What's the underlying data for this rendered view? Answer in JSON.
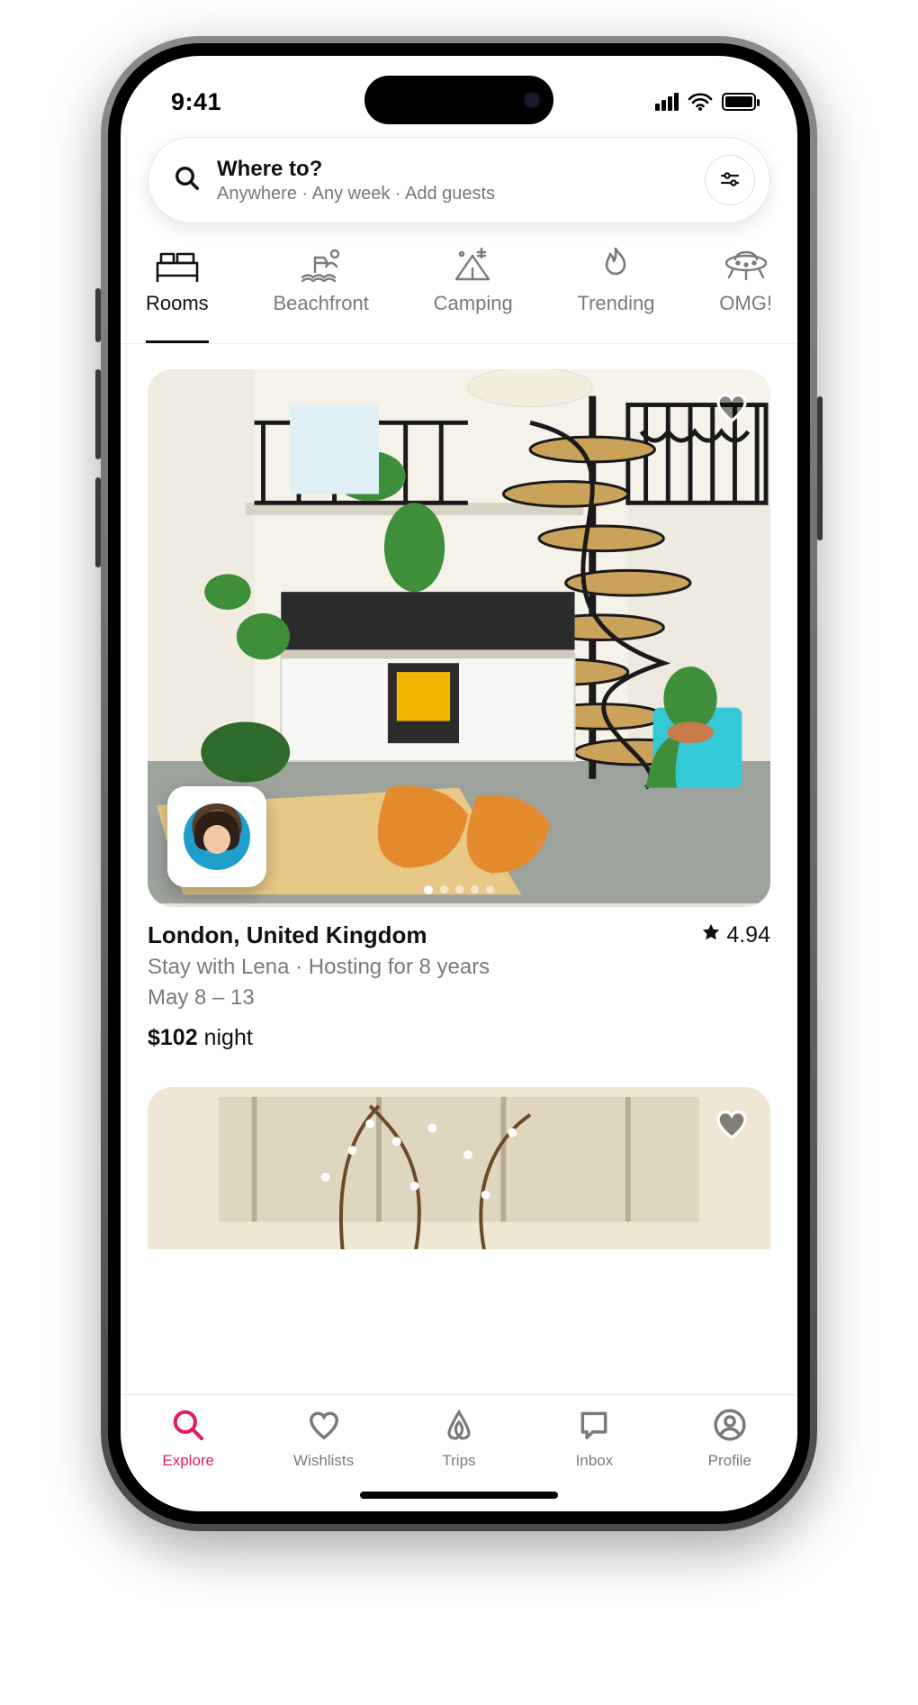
{
  "status": {
    "time": "9:41"
  },
  "search": {
    "title": "Where to?",
    "subtitle": "Anywhere · Any week · Add guests"
  },
  "categories": [
    {
      "label": "Rooms",
      "icon": "bed",
      "active": true
    },
    {
      "label": "Beachfront",
      "icon": "beach",
      "active": false
    },
    {
      "label": "Camping",
      "icon": "camp",
      "active": false
    },
    {
      "label": "Trending",
      "icon": "flame",
      "active": false
    },
    {
      "label": "OMG!",
      "icon": "ufo",
      "active": false
    }
  ],
  "listing": {
    "location": "London, United Kingdom",
    "rating": "4.94",
    "host_line": "Stay with Lena · Hosting for 8 years",
    "dates": "May 8 – 13",
    "price": "$102",
    "price_unit": "night",
    "total_images": 5,
    "current_image_index": 0
  },
  "bottom_nav": [
    {
      "label": "Explore",
      "icon": "search",
      "active": true
    },
    {
      "label": "Wishlists",
      "icon": "heart",
      "active": false
    },
    {
      "label": "Trips",
      "icon": "logo",
      "active": false
    },
    {
      "label": "Inbox",
      "icon": "chat",
      "active": false
    },
    {
      "label": "Profile",
      "icon": "person",
      "active": false
    }
  ]
}
